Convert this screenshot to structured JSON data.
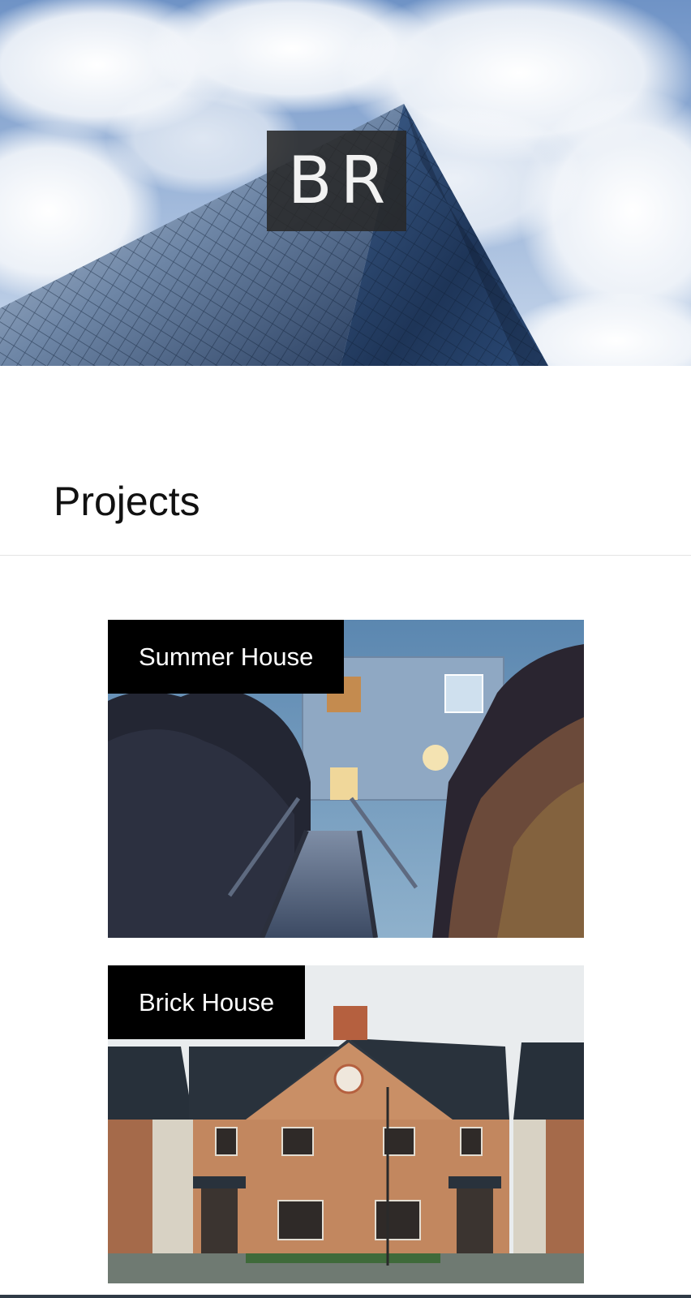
{
  "hero": {
    "logo_text": "BR"
  },
  "section": {
    "title": "Projects"
  },
  "projects": [
    {
      "label": "Summer House"
    },
    {
      "label": "Brick House"
    }
  ],
  "colors": {
    "label_background": "#000000",
    "label_text": "#ffffff",
    "logo_background": "#282828"
  }
}
